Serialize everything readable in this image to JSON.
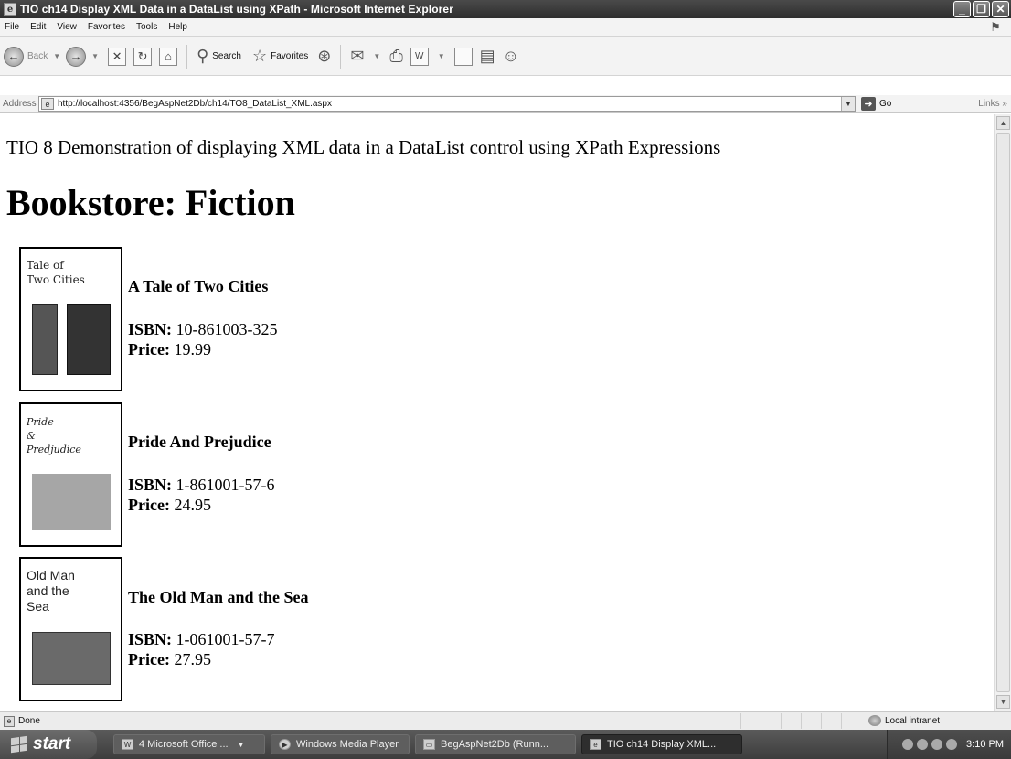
{
  "window": {
    "title": "TIO ch14 Display XML Data in a DataList using XPath - Microsoft Internet Explorer"
  },
  "menu": {
    "items": [
      "File",
      "Edit",
      "View",
      "Favorites",
      "Tools",
      "Help"
    ]
  },
  "toolbar": {
    "back_label": "Back",
    "search_label": "Search",
    "favorites_label": "Favorites"
  },
  "address": {
    "label": "Address",
    "url": "http://localhost:4356/BegAspNet2Db/ch14/TO8_DataList_XML.aspx",
    "go_label": "Go",
    "links_label": "Links"
  },
  "page": {
    "heading": "TIO 8 Demonstration of displaying XML data in a DataList control using XPath Expressions",
    "title": "Bookstore: Fiction",
    "isbn_label": "ISBN:",
    "price_label": "Price:",
    "books": [
      {
        "cover_lines": [
          "Tale of",
          "Two Cities"
        ],
        "title": "A Tale of Two Cities",
        "isbn": "10-861003-325",
        "price": "19.99"
      },
      {
        "cover_lines": [
          "Pride",
          "&",
          "Predjudice"
        ],
        "title": "Pride And Prejudice",
        "isbn": "1-861001-57-6",
        "price": "24.95"
      },
      {
        "cover_lines": [
          "Old Man",
          "and the",
          "Sea"
        ],
        "title": "The Old Man and the Sea",
        "isbn": "1-061001-57-7",
        "price": "27.95"
      }
    ]
  },
  "status": {
    "text": "Done",
    "zone": "Local intranet"
  },
  "taskbar": {
    "start_label": "start",
    "tasks": [
      "4 Microsoft Office ...",
      "Windows Media Player",
      "BegAspNet2Db (Runn...",
      "TIO ch14 Display XML..."
    ],
    "clock": "3:10 PM"
  }
}
